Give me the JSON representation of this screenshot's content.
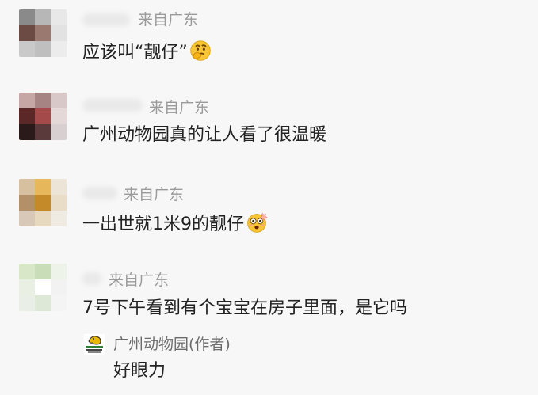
{
  "comments": [
    {
      "location": "来自广东",
      "text": "应该叫“靓仔”",
      "emoji": "thinking-face-icon",
      "avatar_colors": [
        "#8a8a8a",
        "#b7b7b7",
        "#e8e8e8",
        "#6b4b44",
        "#9a7a70",
        "#e2e2e2",
        "#c9c9c9",
        "#bfbfbf",
        "#ececec"
      ]
    },
    {
      "location": "来自广东",
      "text": "广州动物园真的让人看了很温暖",
      "emoji": "",
      "avatar_colors": [
        "#c6a7a6",
        "#a68484",
        "#d8c8c8",
        "#5b2727",
        "#a44a4a",
        "#e4d8d8",
        "#2a1a1a",
        "#5a3a3a",
        "#d8d0d0"
      ]
    },
    {
      "location": "来自广东",
      "text": "一出世就1米9的靓仔",
      "emoji": "flushed-face-icon",
      "avatar_colors": [
        "#d6c0a0",
        "#e7b85b",
        "#ece4d6",
        "#b49068",
        "#c48a2a",
        "#e9ddc8",
        "#d8c8b8",
        "#e7d8c0",
        "#f0ebe2"
      ]
    },
    {
      "location": "来自广东",
      "text": "7号下午看到有个宝宝在房子里面，是它吗",
      "emoji": "",
      "avatar_colors": [
        "#d7e7c8",
        "#c8ddb8",
        "#eef3ea",
        "#e9f0e3",
        "#ffffff",
        "#f2f2f2",
        "#e9efe6",
        "#dde8d6",
        "#f4f4f4"
      ]
    }
  ],
  "reply": {
    "name": "广州动物园(作者)",
    "text": "好眼力",
    "avatar_icon": "zoo-logo-icon"
  }
}
